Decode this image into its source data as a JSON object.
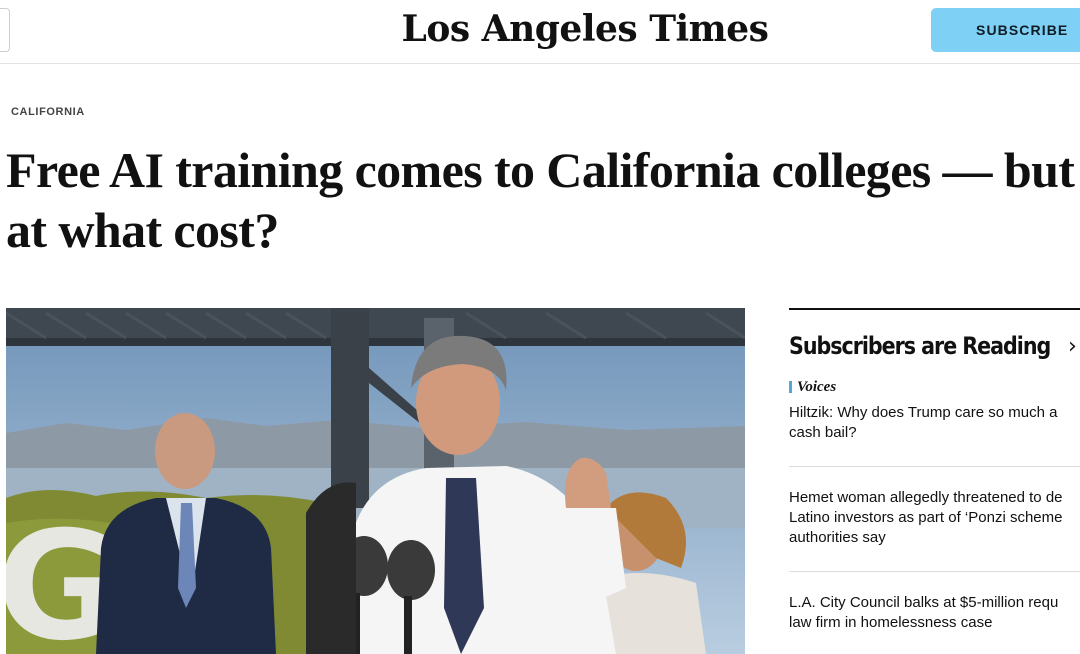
{
  "header": {
    "masthead": "Los Angeles Times",
    "subscribe_label": "SUBSCRIBE"
  },
  "article": {
    "section": "CALIFORNIA",
    "headline": "Free AI training comes to California colleges — but at what cost?",
    "photo_logo_letters": "GO"
  },
  "rail": {
    "title": "Subscribers are Reading",
    "chevron": "›",
    "stories": [
      {
        "kicker": "Voices",
        "headline": "Hiltzik: Why does Trump care so much a\ncash bail?"
      },
      {
        "kicker": "",
        "headline": "Hemet woman allegedly threatened to de\nLatino investors as part of ‘Ponzi scheme\nauthorities say"
      },
      {
        "kicker": "",
        "headline": "L.A. City Council balks at $5-million requ\nlaw firm in homelessness case"
      }
    ]
  },
  "colors": {
    "subscribe_bg": "#7fd0f5",
    "voices_accent": "#4fa8d6",
    "rule": "#111111"
  }
}
